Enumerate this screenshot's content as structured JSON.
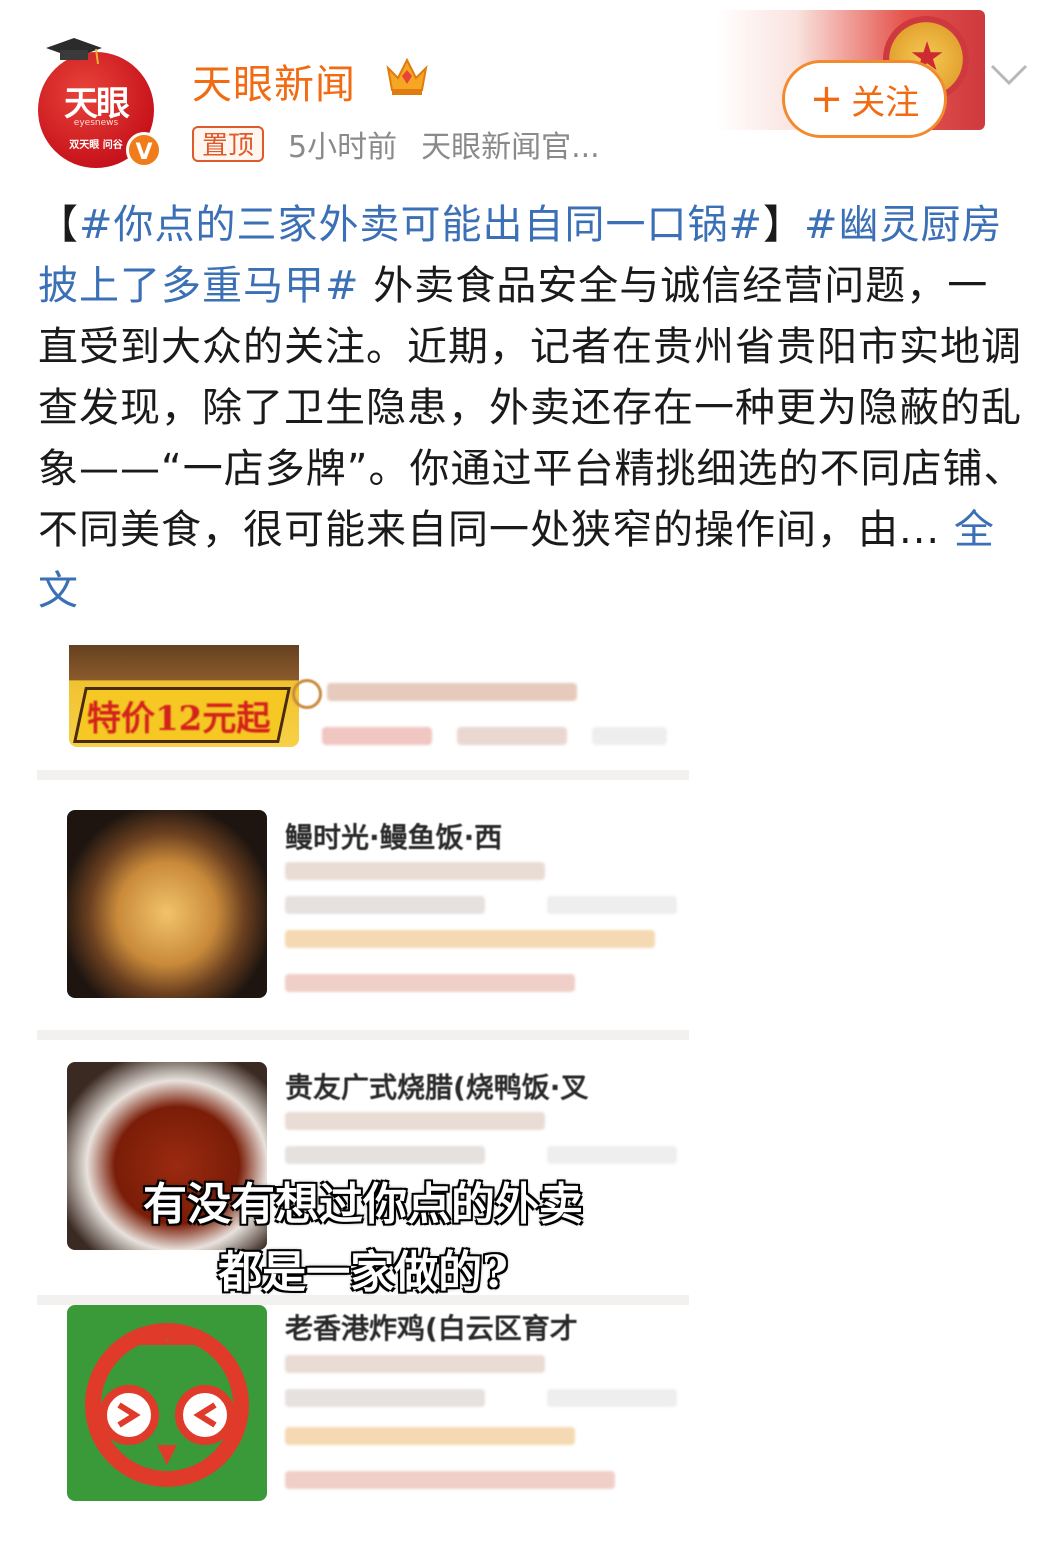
{
  "header": {
    "account_name": "天眼新闻",
    "avatar_text": "天眼",
    "avatar_sub": "eyesnews",
    "avatar_sub2": "双天眼 问谷",
    "verified_mark": "V",
    "pinned_label": "置顶",
    "time_ago": "5小时前",
    "source": "天眼新闻官...",
    "follow_label": "关注",
    "follow_icon": "plus-icon"
  },
  "post": {
    "bracket_open": "【",
    "hashtag_1": "#你点的三家外卖可能出自同一口锅#",
    "bracket_close": "】",
    "hashtag_2": "#幽灵厨房披上了多重马甲#",
    "body": " 外卖食品安全与诚信经营问题，一直受到大众的关注。近期，记者在贵州省贵阳市实地调查发现，除了卫生隐患，外卖还存在一种更为隐蔽的乱象——“一店多牌”。你通过平台精挑细选的不同店铺、不同美食，很可能来自同一处狭窄的操作间，由...",
    "expand_label": "全文"
  },
  "media": {
    "badge_text": "特价12元起",
    "shops": [
      {
        "title": "鳗时光·鳗鱼饭·西"
      },
      {
        "title": "贵友广式烧腊(烧鸭饭·叉"
      },
      {
        "title": "老香港炸鸡(白云区育才"
      }
    ],
    "caption_line1": "有没有想过你点的外卖",
    "caption_line2": "都是一家做的?"
  },
  "colors": {
    "brand_orange": "#f26b12",
    "link_blue": "#3b6fb6",
    "meta_gray": "#8a8a8a"
  }
}
